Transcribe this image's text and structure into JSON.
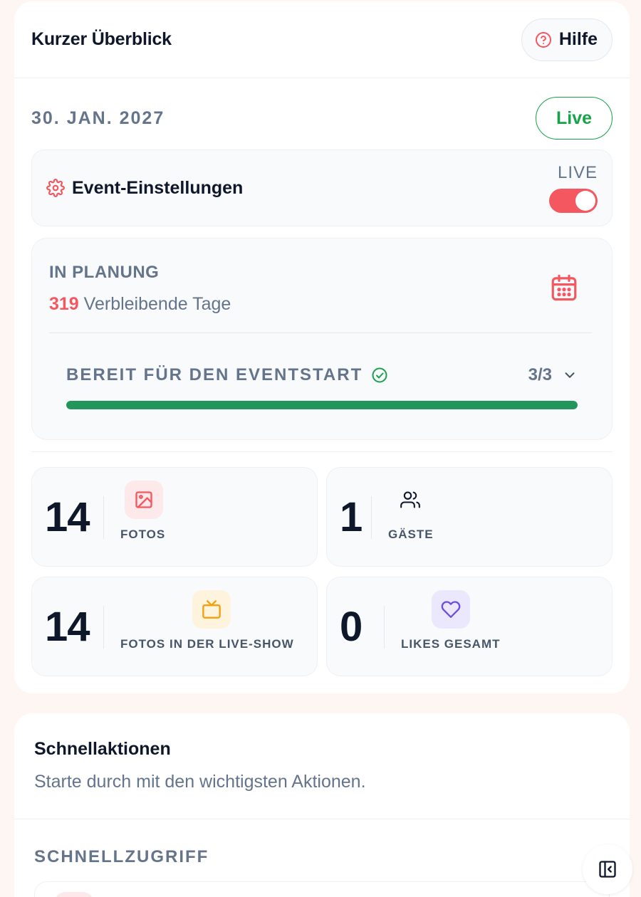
{
  "overview": {
    "title": "Kurzer Überblick",
    "help_label": "Hilfe",
    "date": "30. JAN. 2027",
    "status_pill": "Live",
    "settings": {
      "label": "Event-Einstellungen",
      "live_caption": "LIVE",
      "live_enabled": true
    },
    "planning": {
      "status": "IN PLANUNG",
      "days_count": "319",
      "days_label": "Verbleibende Tage",
      "ready_label": "BEREIT FÜR DEN EVENTSTART",
      "ready_count": "3/3",
      "ready_progress": 1.0
    },
    "stats": [
      {
        "value": "14",
        "label": "FOTOS",
        "icon": "image-icon"
      },
      {
        "value": "1",
        "label": "GÄSTE",
        "icon": "users-icon"
      },
      {
        "value": "14",
        "label": "FOTOS IN DER LIVE-SHOW",
        "icon": "tv-icon"
      },
      {
        "value": "0",
        "label": "LIKES GESAMT",
        "icon": "heart-icon"
      }
    ]
  },
  "quick_actions": {
    "title": "Schnellaktionen",
    "subtitle": "Starte durch mit den wichtigsten Aktionen.",
    "access_label": "SCHNELLZUGRIFF"
  },
  "colors": {
    "accent": "#f4575f",
    "success": "#16a34a",
    "progress": "#22955a",
    "muted": "#64748b",
    "icon_bg_red": "#fde8ea",
    "icon_bg_amber": "#fef3dc",
    "icon_bg_violet": "#ebe7fd"
  }
}
